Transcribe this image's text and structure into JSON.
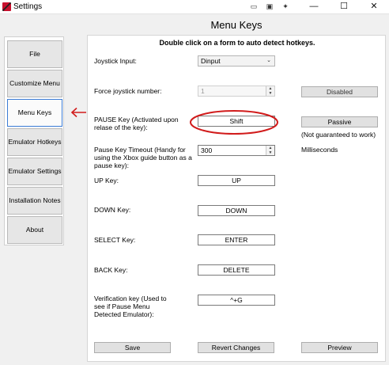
{
  "window": {
    "title": "Settings",
    "controls": {
      "minimize": "—",
      "maximize": "☐",
      "close": "✕"
    }
  },
  "heading": "Menu Keys",
  "hint": "Double click on a form to auto detect hotkeys.",
  "sidebar": {
    "items": [
      {
        "label": "File"
      },
      {
        "label": "Customize Menu"
      },
      {
        "label": "Menu Keys",
        "active": true
      },
      {
        "label": "Emulator Hotkeys"
      },
      {
        "label": "Emulator Settings"
      },
      {
        "label": "Installation Notes"
      },
      {
        "label": "About"
      }
    ]
  },
  "form": {
    "joystick_input": {
      "label": "Joystick Input:",
      "value": "Dinput"
    },
    "force_joystick": {
      "label": "Force joystick number:",
      "value": "1",
      "button": "Disabled"
    },
    "pause_key": {
      "label": "PAUSE Key (Activated upon relase of the key):",
      "value": "Shift",
      "button": "Passive",
      "note": "(Not guaranteed to work)"
    },
    "pause_timeout": {
      "label": "Pause Key Timeout (Handy for using the Xbox guide button as a pause key):",
      "value": "300",
      "unit": "Milliseconds"
    },
    "up_key": {
      "label": "UP Key:",
      "value": "UP"
    },
    "down_key": {
      "label": "DOWN Key:",
      "value": "DOWN"
    },
    "select_key": {
      "label": "SELECT Key:",
      "value": "ENTER"
    },
    "back_key": {
      "label": "BACK Key:",
      "value": "DELETE"
    },
    "verification_key": {
      "label": "Verification key (Used to see if Pause Menu Detected Emulator):",
      "value": "^+G"
    }
  },
  "footer": {
    "save": "Save",
    "revert": "Revert Changes",
    "preview": "Preview"
  },
  "annotation_color": "#d11b1b",
  "active_border_color": "#3a7bd5"
}
